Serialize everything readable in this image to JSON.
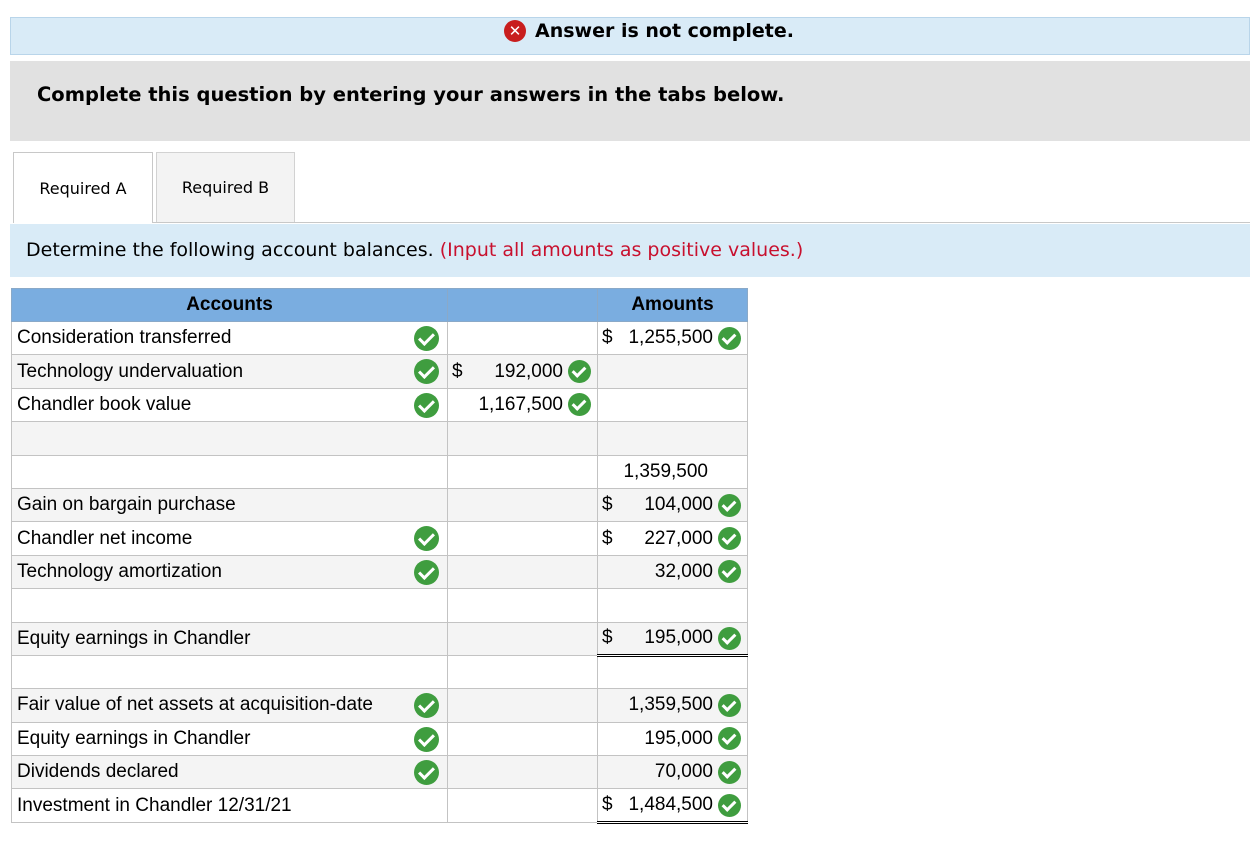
{
  "banner": {
    "status_text": "Answer is not complete.",
    "status_icon": "x-circle-icon"
  },
  "instructions": {
    "text": "Complete this question by entering your answers in the tabs below."
  },
  "tabs": [
    {
      "label": "Required A",
      "active": true
    },
    {
      "label": "Required B",
      "active": false
    }
  ],
  "direction": {
    "text": "Determine the following account balances.",
    "note": "(Input all amounts as positive values.)"
  },
  "table": {
    "headers": {
      "accounts": "Accounts",
      "middle": "",
      "amounts": "Amounts"
    },
    "rows": [
      {
        "account": "Consideration transferred",
        "mid_dollar": "",
        "mid": "",
        "amt_dollar": "$",
        "amt": "1,255,500"
      },
      {
        "account": "Technology undervaluation",
        "mid_dollar": "$",
        "mid": "192,000",
        "amt_dollar": "",
        "amt": ""
      },
      {
        "account": "Chandler book value",
        "mid_dollar": "",
        "mid": "1,167,500",
        "amt_dollar": "",
        "amt": ""
      },
      {
        "account": "",
        "mid_dollar": "",
        "mid": "",
        "amt_dollar": "",
        "amt": ""
      },
      {
        "account": "",
        "mid_dollar": "",
        "mid": "",
        "amt_dollar": "",
        "amt": "1,359,500"
      },
      {
        "account": "Gain on bargain purchase",
        "mid_dollar": "",
        "mid": "",
        "amt_dollar": "$",
        "amt": "104,000"
      },
      {
        "account": "Chandler net income",
        "mid_dollar": "",
        "mid": "",
        "amt_dollar": "$",
        "amt": "227,000"
      },
      {
        "account": "Technology amortization",
        "mid_dollar": "",
        "mid": "",
        "amt_dollar": "",
        "amt": "32,000"
      },
      {
        "account": "",
        "mid_dollar": "",
        "mid": "",
        "amt_dollar": "",
        "amt": ""
      },
      {
        "account": "Equity earnings in Chandler",
        "mid_dollar": "",
        "mid": "",
        "amt_dollar": "$",
        "amt": "195,000"
      },
      {
        "account": "",
        "mid_dollar": "",
        "mid": "",
        "amt_dollar": "",
        "amt": ""
      },
      {
        "account": "Fair value of net assets at acquisition-date",
        "mid_dollar": "",
        "mid": "",
        "amt_dollar": "",
        "amt": "1,359,500"
      },
      {
        "account": "Equity earnings in Chandler",
        "mid_dollar": "",
        "mid": "",
        "amt_dollar": "",
        "amt": "195,000"
      },
      {
        "account": "Dividends declared",
        "mid_dollar": "",
        "mid": "",
        "amt_dollar": "",
        "amt": "70,000"
      },
      {
        "account": "Investment in Chandler 12/31/21",
        "mid_dollar": "",
        "mid": "",
        "amt_dollar": "$",
        "amt": "1,484,500"
      }
    ]
  },
  "colors": {
    "banner_bg": "#d9ebf7",
    "header_bg": "#7aade0",
    "check_green": "#3f9d3f",
    "error_red": "#c81e1e",
    "note_red": "#c8102e"
  }
}
